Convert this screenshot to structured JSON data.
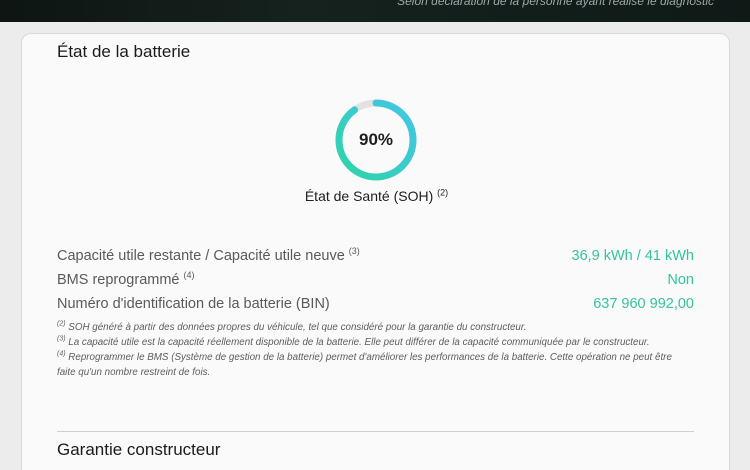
{
  "banner": {
    "text": "Selon déclaration de la personne ayant réalisé le diagnostic"
  },
  "battery": {
    "title": "État de la batterie",
    "soh": {
      "value": "90%",
      "fraction": 0.9,
      "label": "État de Santé (SOH)",
      "note_ref": "(2)"
    },
    "rows": [
      {
        "label": "Capacité utile restante / Capacité utile neuve",
        "ref": "(3)",
        "value": "36,9 kWh / 41 kWh"
      },
      {
        "label": "BMS reprogrammé",
        "ref": "(4)",
        "value": "Non"
      },
      {
        "label": "Numéro d'identification de la batterie (BIN)",
        "ref": "",
        "value": "637 960 992,00"
      }
    ],
    "footnotes": [
      {
        "ref": "(2)",
        "text": "SOH généré à partir des données propres du véhicule, tel que considéré pour la garantie du constructeur."
      },
      {
        "ref": "(3)",
        "text": "La capacité utile est la capacité réellement disponible de la batterie. Elle peut différer de la capacité communiquée par le constructeur."
      },
      {
        "ref": "(4)",
        "text": "Reprogrammer le BMS (Système de gestion de la batterie) permet d'améliorer les performances de la batterie. Cette opération ne peut être faite qu'un nombre restreint de fois."
      }
    ]
  },
  "warranty": {
    "title": "Garantie constructeur"
  },
  "colors": {
    "accent": "#32c49b",
    "gauge_start": "#2ed3a8",
    "gauge_end": "#43c6e8"
  }
}
